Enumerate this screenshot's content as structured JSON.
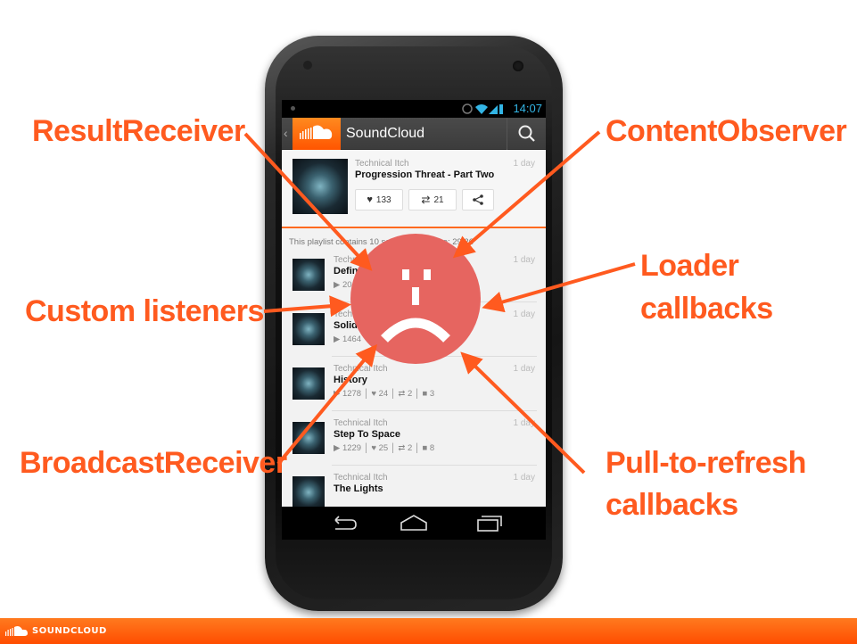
{
  "labels": {
    "result_receiver": "ResultReceiver",
    "content_observer": "ContentObserver",
    "custom_listeners": "Custom listeners",
    "loader_line1": "Loader",
    "loader_line2": "callbacks",
    "broadcast_receiver": "BroadcastReceiver",
    "pull_line1": "Pull-to-refresh",
    "pull_line2": "callbacks"
  },
  "status_bar": {
    "time": "14:07"
  },
  "action_bar": {
    "title": "SoundCloud"
  },
  "header_track": {
    "artist": "Technical Itch",
    "title": "Progression Threat - Part Two",
    "age": "1 day",
    "likes": "133",
    "reposts": "21"
  },
  "playlist_info": "This playlist contains 10 sounds, total time: 29:26",
  "tracks": [
    {
      "artist": "Technic",
      "title": "Defin",
      "stats": "▶ 20",
      "age": "1 day"
    },
    {
      "artist": "Techni",
      "title": "Solid",
      "stats": "▶ 1464",
      "age": "1 day"
    },
    {
      "artist": "Technical Itch",
      "title": "History",
      "plays": "1278",
      "likes": "24",
      "reposts": "2",
      "comments": "3",
      "age": "1 day"
    },
    {
      "artist": "Technical Itch",
      "title": "Step To Space",
      "plays": "1229",
      "likes": "25",
      "reposts": "2",
      "comments": "8",
      "age": "1 day"
    },
    {
      "artist": "Technical Itch",
      "title": "The Lights",
      "age": "1 day"
    }
  ],
  "brand": {
    "name": "SOUNDCLOUD",
    "accent": "#ff5500",
    "label_color": "#ff5a1f",
    "face_color": "#e66560"
  },
  "icons": [
    "search-icon",
    "heart-icon",
    "repost-icon",
    "share-icon",
    "back-icon",
    "home-icon",
    "recents-icon",
    "wifi-icon",
    "signal-icon",
    "battery-icon",
    "soundcloud-logo"
  ]
}
